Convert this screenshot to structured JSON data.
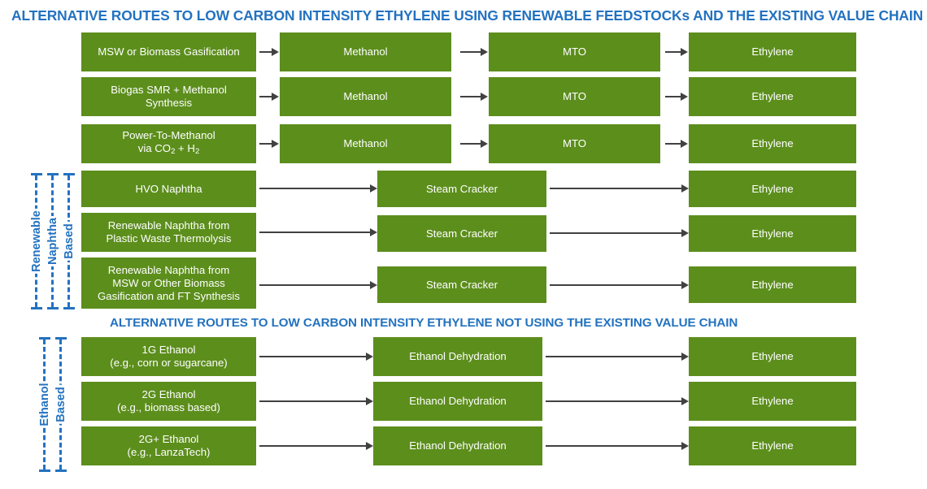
{
  "colors": {
    "box_green": "#5C8E1C",
    "title_blue": "#2372C0",
    "arrow_gray": "#414141",
    "box_text": "#FFFFFF",
    "background": "#FFFFFF"
  },
  "titles": {
    "main": "ALTERNATIVE ROUTES TO LOW CARBON INTENSITY ETHYLENE USING RENEWABLE FEEDSTOCKs AND THE EXISTING VALUE CHAIN",
    "second": "ALTERNATIVE ROUTES TO LOW CARBON INTENSITY ETHYLENE NOT USING THE EXISTING VALUE CHAIN"
  },
  "brackets": {
    "renewable_naphtha_based": [
      "Renewable",
      "Naphtha",
      "Based"
    ],
    "ethanol_based": [
      "Ethanol",
      "Based"
    ]
  },
  "rows": [
    {
      "id": "row-msw-gasification",
      "feedstock_line1": "MSW or Biomass Gasification",
      "feedstock_line2": "",
      "feedstock_line3": "",
      "intermediate": "Methanol",
      "conversion": "MTO",
      "product": "Ethylene"
    },
    {
      "id": "row-biogas-smr",
      "feedstock_line1": "Biogas SMR + Methanol",
      "feedstock_line2": "Synthesis",
      "feedstock_line3": "",
      "intermediate": "Methanol",
      "conversion": "MTO",
      "product": "Ethylene"
    },
    {
      "id": "row-power-to-methanol",
      "feedstock_line1": "Power-To-Methanol",
      "feedstock_line2": "via CO2 + H2",
      "feedstock_line3": "",
      "intermediate": "Methanol",
      "conversion": "MTO",
      "product": "Ethylene"
    },
    {
      "id": "row-hvo-naphtha",
      "feedstock_line1": "HVO Naphtha",
      "feedstock_line2": "",
      "feedstock_line3": "",
      "process": "Steam Cracker",
      "product": "Ethylene"
    },
    {
      "id": "row-plastic-waste-thermolysis",
      "feedstock_line1": "Renewable Naphtha from",
      "feedstock_line2": "Plastic Waste Thermolysis",
      "feedstock_line3": "",
      "process": "Steam Cracker",
      "product": "Ethylene"
    },
    {
      "id": "row-msw-ft-synthesis",
      "feedstock_line1": "Renewable Naphtha from",
      "feedstock_line2": "MSW or Other Biomass",
      "feedstock_line3": "Gasification and FT Synthesis",
      "process": "Steam Cracker",
      "product": "Ethylene"
    },
    {
      "id": "row-1g-ethanol",
      "feedstock_line1": "1G Ethanol",
      "feedstock_line2": "(e.g., corn or sugarcane)",
      "feedstock_line3": "",
      "process": "Ethanol Dehydration",
      "product": "Ethylene"
    },
    {
      "id": "row-2g-ethanol",
      "feedstock_line1": "2G Ethanol",
      "feedstock_line2": "(e.g., biomass based)",
      "feedstock_line3": "",
      "process": "Ethanol Dehydration",
      "product": "Ethylene"
    },
    {
      "id": "row-2gplus-ethanol",
      "feedstock_line1": "2G+ Ethanol",
      "feedstock_line2": "(e.g., LanzaTech)",
      "feedstock_line3": "",
      "process": "Ethanol Dehydration",
      "product": "Ethylene"
    }
  ]
}
